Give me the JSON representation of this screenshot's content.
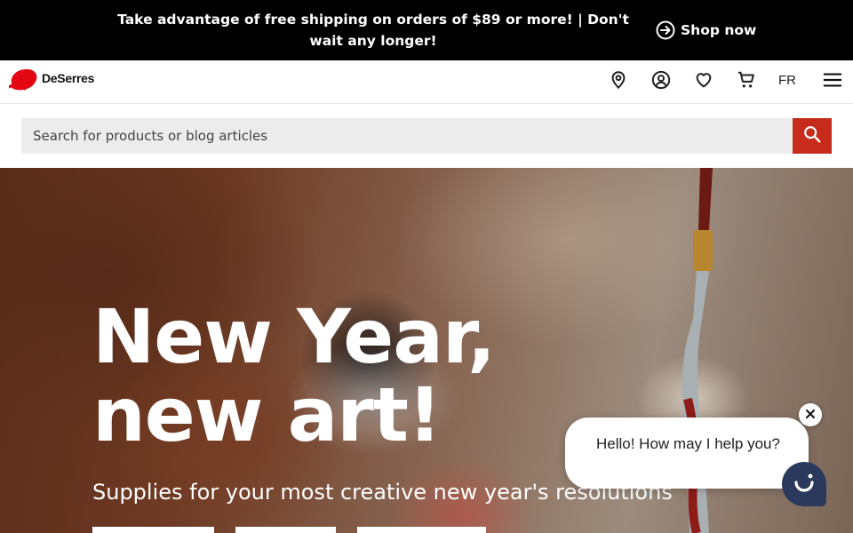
{
  "promo": {
    "message": "Take advantage of free shipping on orders of $89 or more! | Don't wait any longer!",
    "cta_label": "Shop now"
  },
  "header": {
    "logo_text": "DeSerres",
    "brand_color": "#e30613",
    "icons": [
      "location-pin-icon",
      "account-icon",
      "heart-icon",
      "cart-icon",
      "menu-icon"
    ],
    "language_label": "FR"
  },
  "search": {
    "placeholder": "Search for products or blog articles",
    "button_color": "#c62b1b"
  },
  "hero": {
    "title_line1": "New Year,",
    "title_line2": "new art!",
    "subtitle": "Supplies for your most creative new year's resolutions"
  },
  "chat": {
    "message": "Hello! How may I help you?",
    "launcher_color": "#2b3a5c"
  }
}
